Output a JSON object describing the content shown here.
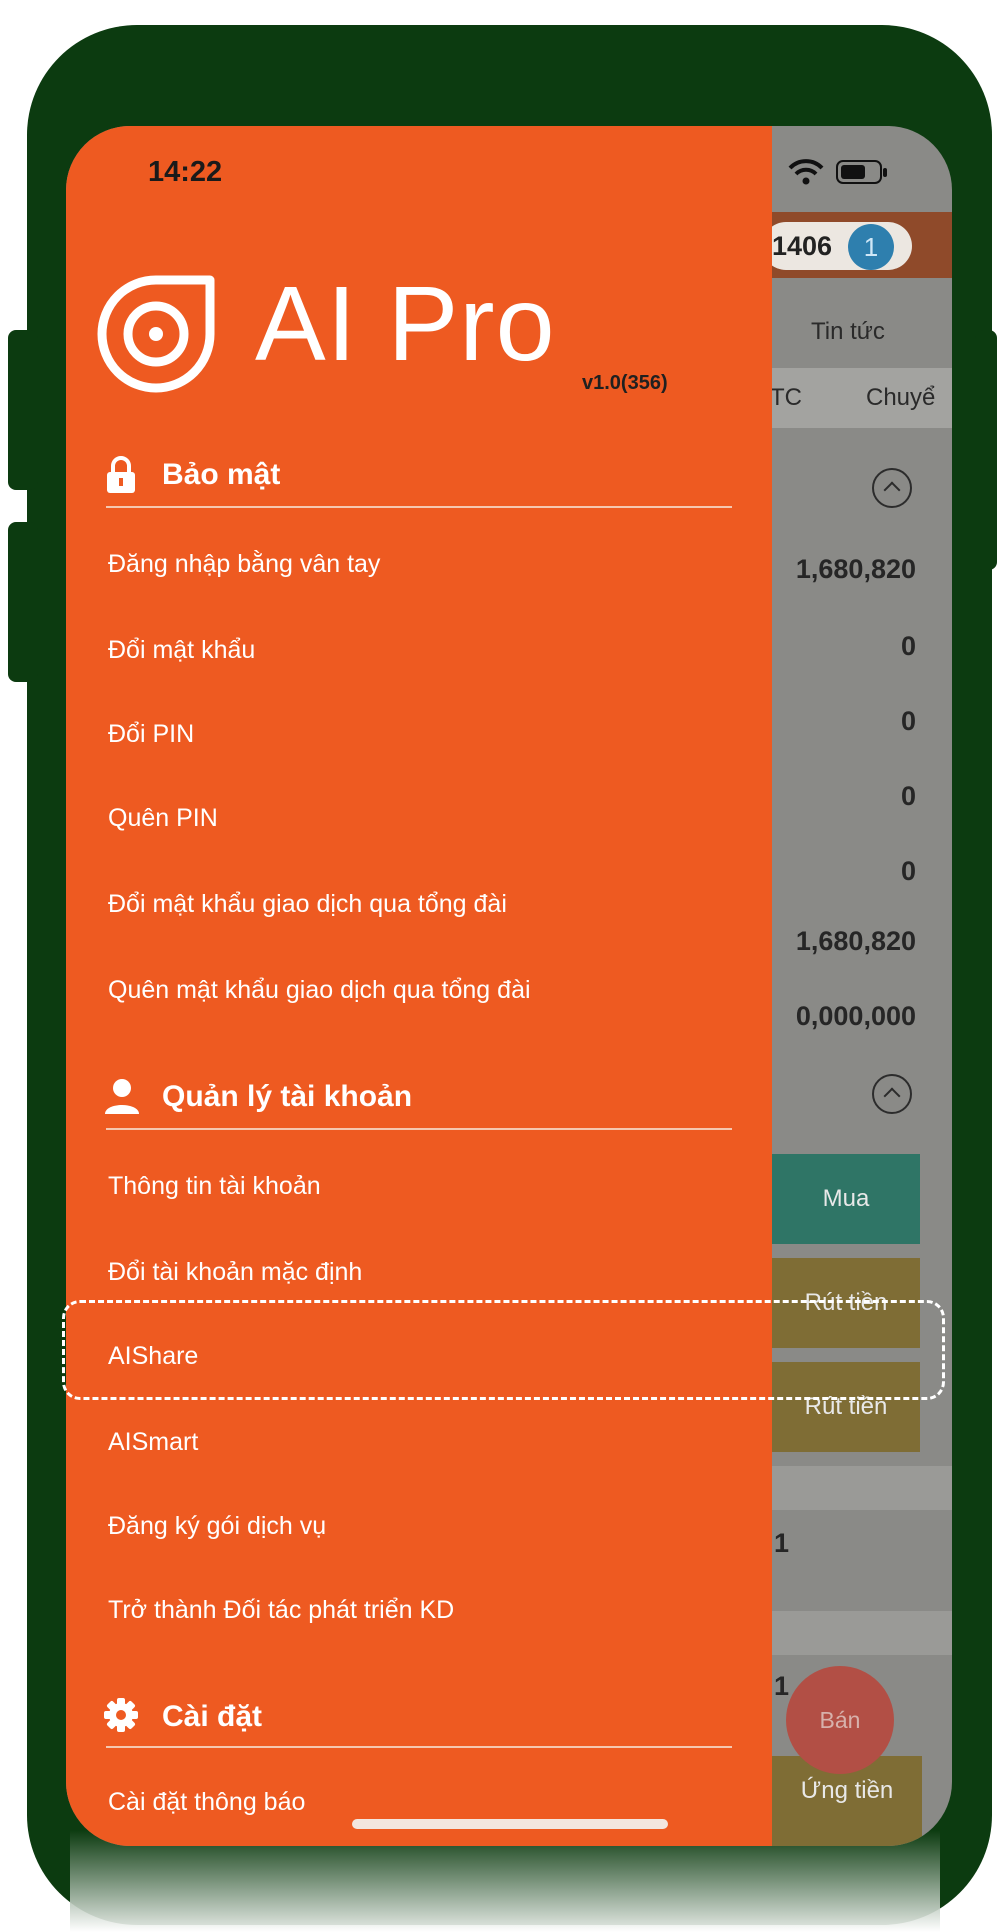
{
  "status_bar": {
    "time": "14:22"
  },
  "logo": {
    "wordmark": "AI Pro",
    "version": "v1.0(356)"
  },
  "drawer": {
    "sections": [
      {
        "title": "Bảo mật",
        "icon": "lock-icon",
        "items": [
          "Đăng nhập bằng vân tay",
          "Đổi mật khẩu",
          "Đổi PIN",
          "Quên PIN",
          "Đổi mật khẩu giao dịch qua tổng đài",
          "Quên mật khẩu giao dịch qua tổng đài"
        ]
      },
      {
        "title": "Quản lý tài khoản",
        "icon": "user-icon",
        "items": [
          "Thông tin tài khoản",
          "Đổi tài khoản mặc định",
          "AIShare",
          "AISmart",
          "Đăng ký gói dịch vụ",
          "Trở thành Đối tác phát triển KD"
        ]
      },
      {
        "title": "Cài đặt",
        "icon": "gear-icon",
        "items": [
          "Cài đặt thông báo"
        ]
      }
    ]
  },
  "background_app": {
    "account_fragment": "1406",
    "notification_count": "1",
    "tab_news": "Tin tức",
    "subtab_left": "TC",
    "subtab_right": "Chuyể",
    "values": [
      "1,680,820",
      "0",
      "0",
      "0",
      "0",
      "1,680,820",
      "0,000,000"
    ],
    "button_buy": "Mua",
    "button_withdraw_1": "Rút tiền",
    "button_withdraw_2": "Rút tiền",
    "small_value_1": "1",
    "small_value_2": "1",
    "fab_sell": "Bán",
    "button_advance": "Ứng tiền"
  },
  "colors": {
    "drawer_bg": "#ee5a21",
    "frame": "#0c3b10",
    "buy_button": "#2f8a7a",
    "withdraw_button": "#8f7a3a"
  }
}
